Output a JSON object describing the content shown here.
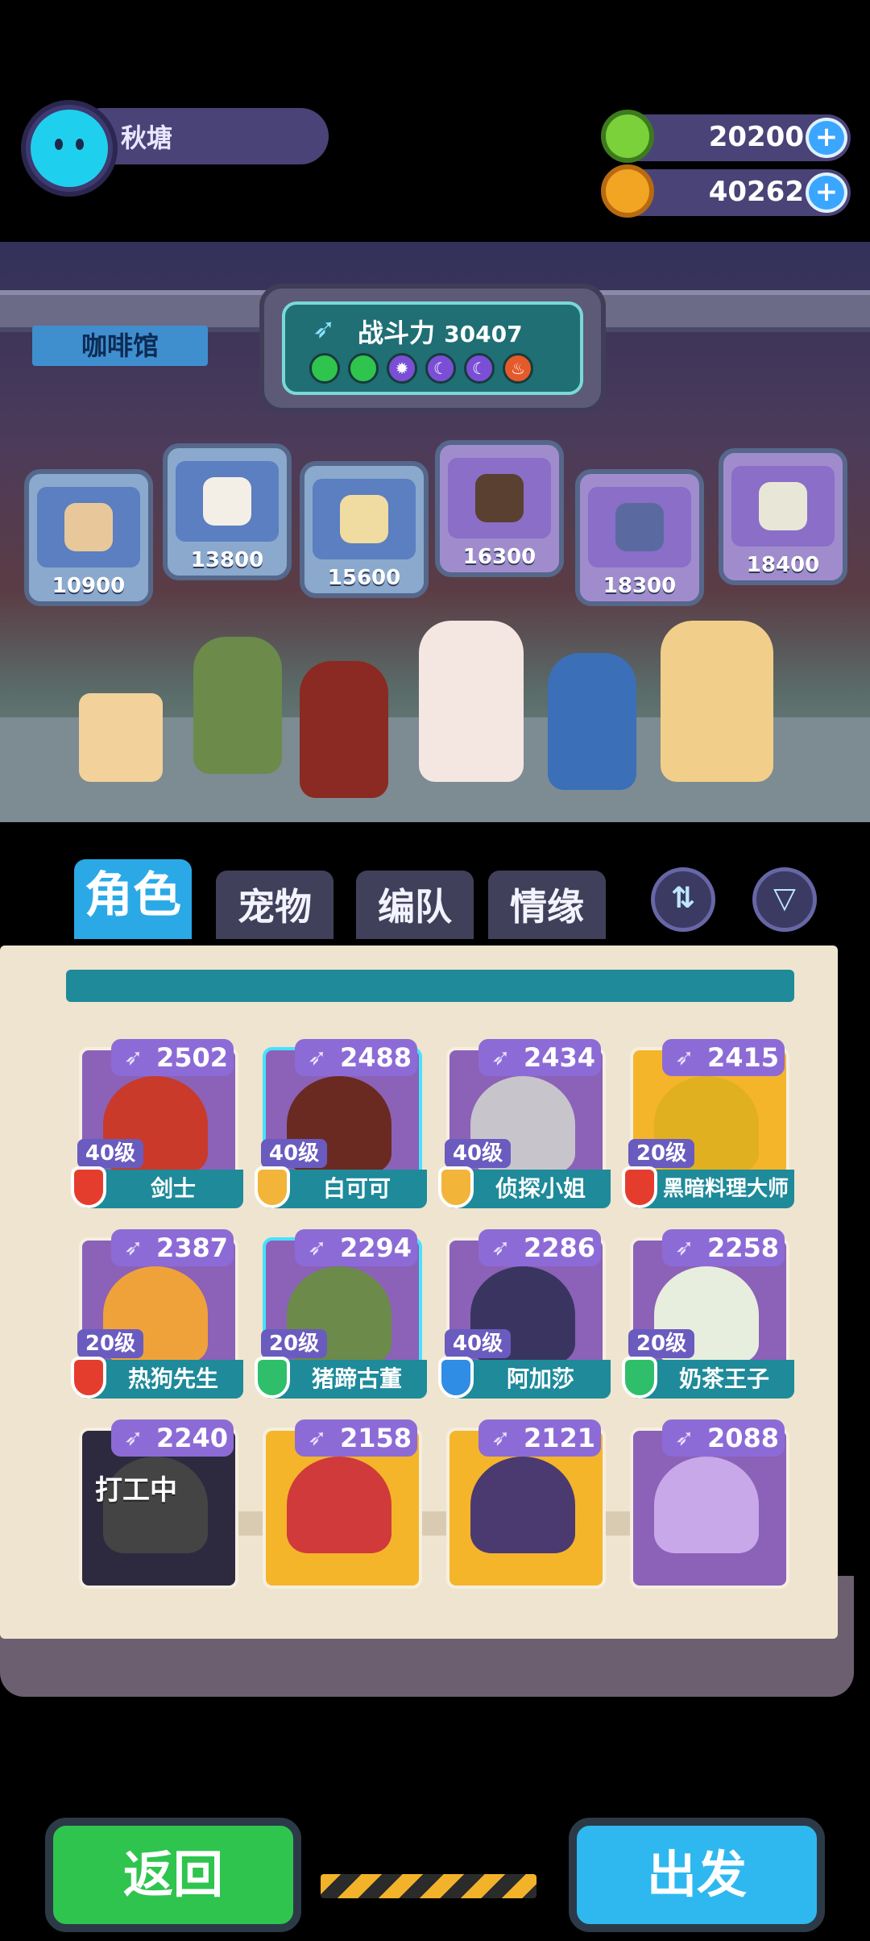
{
  "player": {
    "name": "秋塘"
  },
  "currency": [
    {
      "icon": "donut-icon",
      "value": "20200",
      "color": "#7ad13a"
    },
    {
      "icon": "planet-icon",
      "value": "40262",
      "color": "#f2a522"
    }
  ],
  "stage": {
    "location_tag": "咖啡馆",
    "power_label": "战斗力",
    "power_value": "30407",
    "element_dots": [
      {
        "icon": "green-orb-icon",
        "color": "#2fc44e"
      },
      {
        "icon": "green-orb-icon",
        "color": "#2fc44e"
      },
      {
        "icon": "sun-icon",
        "color": "#7a4fd6"
      },
      {
        "icon": "moon-icon",
        "color": "#7a4fd6"
      },
      {
        "icon": "moon-icon",
        "color": "#7a4fd6"
      },
      {
        "icon": "fire-icon",
        "color": "#e55a2a"
      }
    ],
    "pets": [
      {
        "power": "10900"
      },
      {
        "power": "13800"
      },
      {
        "power": "15600"
      },
      {
        "power": "16300"
      },
      {
        "power": "18300"
      },
      {
        "power": "18400"
      }
    ]
  },
  "tabs": [
    {
      "label": "角色",
      "active": true
    },
    {
      "label": "宠物",
      "active": false
    },
    {
      "label": "编队",
      "active": false
    },
    {
      "label": "情缘",
      "active": false
    }
  ],
  "characters": [
    {
      "power": "2502",
      "level": "40级",
      "name": "剑士",
      "shield": "red",
      "bg": "purple"
    },
    {
      "power": "2488",
      "level": "40级",
      "name": "白可可",
      "shield": "yellow",
      "bg": "purple"
    },
    {
      "power": "2434",
      "level": "40级",
      "name": "侦探小姐",
      "shield": "yellow",
      "bg": "purple"
    },
    {
      "power": "2415",
      "level": "20级",
      "name": "黑暗料理大师",
      "shield": "red",
      "bg": "yellow"
    },
    {
      "power": "2387",
      "level": "20级",
      "name": "热狗先生",
      "shield": "red",
      "bg": "purple"
    },
    {
      "power": "2294",
      "level": "20级",
      "name": "猪蹄古董",
      "shield": "green",
      "bg": "purple"
    },
    {
      "power": "2286",
      "level": "40级",
      "name": "阿加莎",
      "shield": "blue",
      "bg": "purple"
    },
    {
      "power": "2258",
      "level": "20级",
      "name": "奶茶王子",
      "shield": "green",
      "bg": "purple"
    },
    {
      "power": "2240",
      "status": "打工中",
      "bg": "purple"
    },
    {
      "power": "2158",
      "bg": "yellow"
    },
    {
      "power": "2121",
      "bg": "yellow"
    },
    {
      "power": "2088",
      "bg": "purple"
    }
  ],
  "buttons": {
    "back": "返回",
    "go": "出发"
  }
}
